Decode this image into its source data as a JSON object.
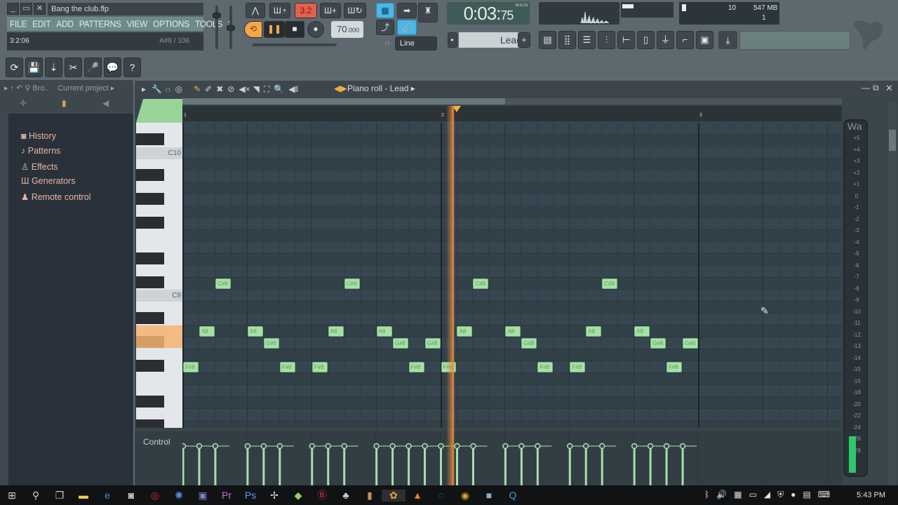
{
  "window": {
    "title": "Bang the club.flp"
  },
  "menu": [
    "FILE",
    "EDIT",
    "ADD",
    "PATTERNS",
    "VIEW",
    "OPTIONS",
    "TOOLS",
    "?"
  ],
  "hint": {
    "position": "3:2:06",
    "note_info": "A#8 / 106"
  },
  "transport": {
    "snap_label": "3.2",
    "tempo": "70",
    "tempo_decimals": ".000",
    "time_main": "0:03:",
    "time_cs": "75",
    "time_format": "M:S:CS",
    "pattern": "Lead",
    "snap_mode": "Line"
  },
  "cpu": {
    "voices": "10",
    "memory": "547 MB",
    "polyphony": "1"
  },
  "browser": {
    "header_short": "Bro..",
    "header_path": "Current project",
    "root": "Current project",
    "items": [
      "History",
      "Patterns",
      "Effects",
      "Generators",
      "Remote control"
    ]
  },
  "piano_roll": {
    "title": "Piano roll - Lead",
    "bar_labels": [
      "1",
      "2",
      "3"
    ],
    "key_labels": [
      "C10",
      "C9"
    ],
    "control_label": "Control",
    "meter_title": "Wa",
    "meter_scale": [
      "+5",
      "+4",
      "+3",
      "+2",
      "+1",
      "0",
      "-1",
      "-2",
      "-3",
      "-4",
      "-5",
      "-6",
      "-7",
      "-8",
      "-9",
      "-10",
      "-11",
      "-12",
      "-13",
      "-14",
      "-15",
      "-16",
      "-18",
      "-20",
      "-22",
      "-24",
      "-26",
      "-28"
    ],
    "notes": [
      {
        "pitch": "F#8",
        "step": 0
      },
      {
        "pitch": "A8",
        "step": 1
      },
      {
        "pitch": "C#9",
        "step": 2
      },
      {
        "pitch": "A8",
        "step": 4
      },
      {
        "pitch": "G#8",
        "step": 5
      },
      {
        "pitch": "F#8",
        "step": 6
      },
      {
        "pitch": "F#8",
        "step": 8
      },
      {
        "pitch": "A8",
        "step": 9
      },
      {
        "pitch": "C#9",
        "step": 10
      },
      {
        "pitch": "A8",
        "step": 12
      },
      {
        "pitch": "G#8",
        "step": 13
      },
      {
        "pitch": "F#8",
        "step": 14
      },
      {
        "pitch": "G#8",
        "step": 15
      },
      {
        "pitch": "F#8",
        "step": 16
      },
      {
        "pitch": "A8",
        "step": 17
      },
      {
        "pitch": "C#9",
        "step": 18
      },
      {
        "pitch": "A8",
        "step": 20
      },
      {
        "pitch": "G#8",
        "step": 21
      },
      {
        "pitch": "F#8",
        "step": 22
      },
      {
        "pitch": "F#8",
        "step": 24
      },
      {
        "pitch": "A8",
        "step": 25
      },
      {
        "pitch": "C#9",
        "step": 26
      },
      {
        "pitch": "A8",
        "step": 28
      },
      {
        "pitch": "G#8",
        "step": 29
      },
      {
        "pitch": "F#8",
        "step": 30
      },
      {
        "pitch": "G#8",
        "step": 31
      }
    ],
    "playhead_step": 16.9
  },
  "taskbar": {
    "clock": "5:43 PM"
  }
}
